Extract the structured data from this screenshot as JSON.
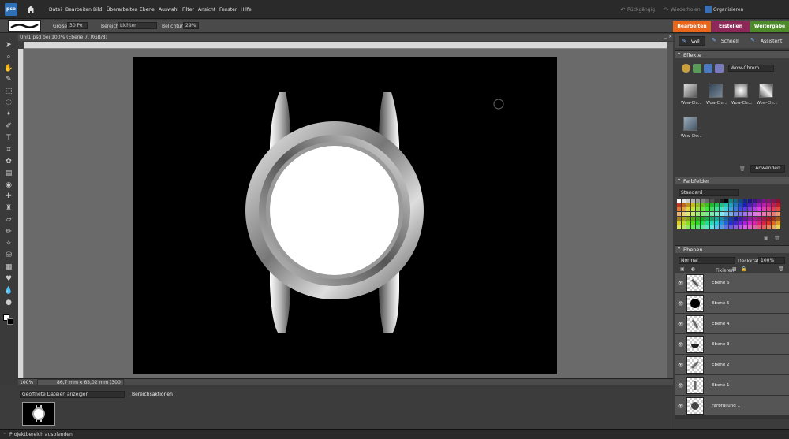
{
  "app": {
    "logo": "pse",
    "home_icon": "home-icon"
  },
  "menu": [
    "Datei",
    "Bearbeiten",
    "Bild",
    "Überarbeiten",
    "Ebene",
    "Auswahl",
    "Filter",
    "Ansicht",
    "Fenster",
    "Hilfe"
  ],
  "history": {
    "undo": "Rückgängig",
    "redo": "Wiederholen",
    "organize": "Organisieren"
  },
  "mode_tabs": [
    {
      "label": "Bearbeiten",
      "color": "#e8651a"
    },
    {
      "label": "Erstellen",
      "color": "#9a2a5a"
    },
    {
      "label": "Weitergabe",
      "color": "#4e8a2a"
    }
  ],
  "options": {
    "size_label": "Größe:",
    "size_value": "30 Px",
    "range_label": "Bereich:",
    "range_value": "Lichter",
    "exposure_label": "Belichtung:",
    "exposure_value": "29%"
  },
  "document": {
    "title": "Uhr1.psd bei 100% (Ebene 7, RGB/8)",
    "zoom": "100%",
    "status": "86,7 mm x 63,02 mm (300 ppi)"
  },
  "bin": {
    "dropdown": "Geöffnete Dateien anzeigen",
    "actions": "Bereichsaktionen"
  },
  "bottom": {
    "hide_bin": "Projektbereich ausblenden"
  },
  "edit_modes": {
    "full": "Voll",
    "quick": "Schnell",
    "guided": "Assistent"
  },
  "effects": {
    "title": "Effekte",
    "dropdown": "Wow-Chrom",
    "items": [
      "Wow-Chr...",
      "Wow-Chr...",
      "Wow-Chr...",
      "Wow-Chr...",
      "Wow-Chr..."
    ],
    "apply": "Anwenden"
  },
  "swatches": {
    "title": "Farbfelder",
    "dropdown": "Standard"
  },
  "layers": {
    "title": "Ebenen",
    "blend": "Normal",
    "opacity_label": "Deckkraft:",
    "opacity_value": "100%",
    "lock_label": "Fixieren:",
    "items": [
      "Ebene 6",
      "Ebene 5",
      "Ebene 4",
      "Ebene 3",
      "Ebene 2",
      "Ebene 1",
      "Farbfüllung 1"
    ]
  }
}
